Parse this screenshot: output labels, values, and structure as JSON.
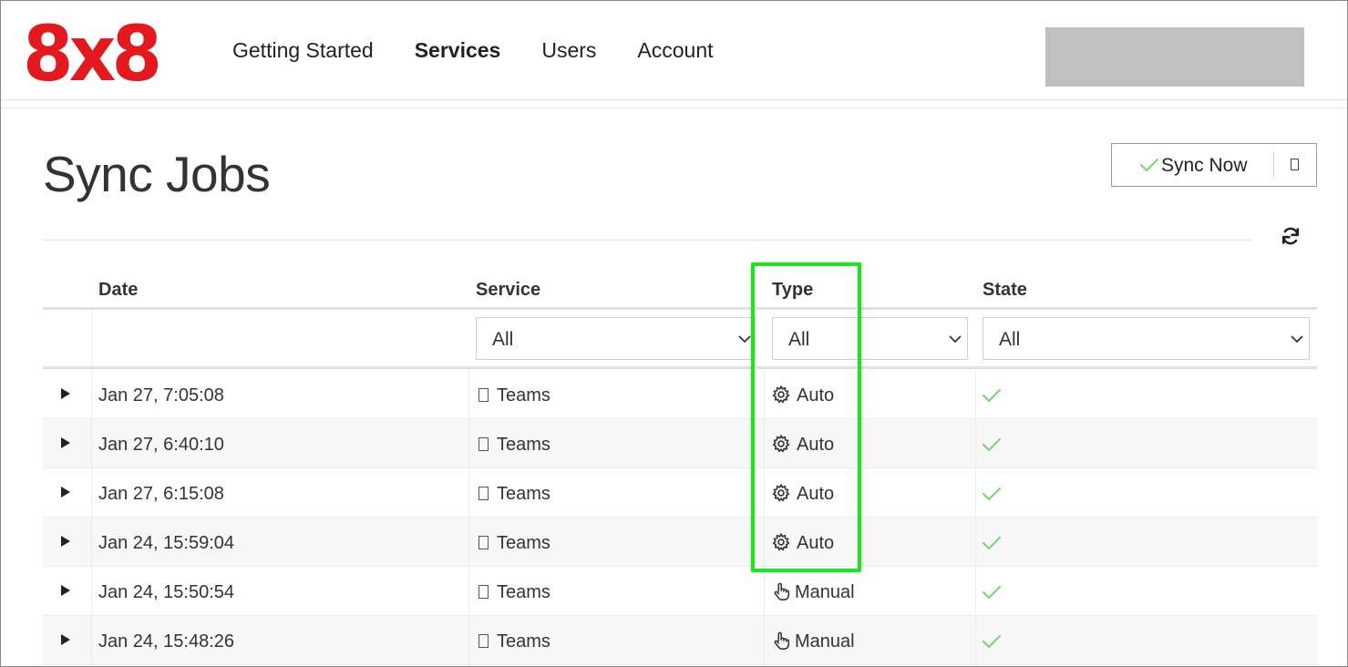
{
  "brand": {
    "logo_text": "8x8",
    "logo_color": "#e4191e"
  },
  "nav": {
    "items": [
      {
        "label": "Getting Started",
        "active": false
      },
      {
        "label": "Services",
        "active": true
      },
      {
        "label": "Users",
        "active": false
      },
      {
        "label": "Account",
        "active": false
      }
    ]
  },
  "page": {
    "title": "Sync Jobs",
    "sync_button_label": "Sync Now",
    "accent_check_color": "#7fd47f",
    "highlight_color": "#22e022"
  },
  "table": {
    "columns": [
      "Date",
      "Service",
      "Type",
      "State"
    ],
    "filters": {
      "service": "All",
      "type": "All",
      "state": "All"
    },
    "rows": [
      {
        "date": "Jan 27, 7:05:08",
        "service": "Teams",
        "type": "Auto",
        "type_icon": "gear-icon",
        "state": "success"
      },
      {
        "date": "Jan 27, 6:40:10",
        "service": "Teams",
        "type": "Auto",
        "type_icon": "gear-icon",
        "state": "success"
      },
      {
        "date": "Jan 27, 6:15:08",
        "service": "Teams",
        "type": "Auto",
        "type_icon": "gear-icon",
        "state": "success"
      },
      {
        "date": "Jan 24, 15:59:04",
        "service": "Teams",
        "type": "Auto",
        "type_icon": "gear-icon",
        "state": "success"
      },
      {
        "date": "Jan 24, 15:50:54",
        "service": "Teams",
        "type": "Manual",
        "type_icon": "hand-pointer-icon",
        "state": "success"
      },
      {
        "date": "Jan 24, 15:48:26",
        "service": "Teams",
        "type": "Manual",
        "type_icon": "hand-pointer-icon",
        "state": "success"
      }
    ]
  }
}
